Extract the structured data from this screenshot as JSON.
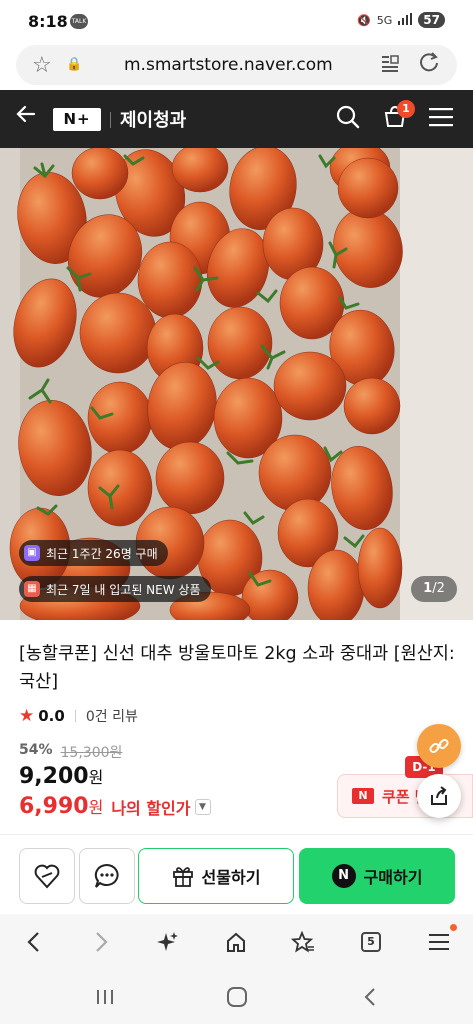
{
  "status_bar": {
    "time": "8:18",
    "talk_label": "TALK",
    "network": "5G",
    "battery": "57"
  },
  "url_bar": {
    "url": "m.smartstore.naver.com"
  },
  "header": {
    "logo": "N+",
    "store_name": "제이청과",
    "cart_count": "1"
  },
  "gallery": {
    "chip_recent_purchase": "최근 1주간 26명 구매",
    "chip_new_stock": "최근 7일 내 입고된 NEW 상품",
    "page_current": "1",
    "page_total": "/2"
  },
  "product": {
    "title": "[농할쿠폰] 신선 대추 방울토마토 2kg 소과 중대과 [원산지: 국산]",
    "rating": "0.0",
    "review_count": "0건 리뷰",
    "discount_rate": "54%",
    "original_price": "15,300원",
    "sale_price": "9,200",
    "sale_price_unit": "원",
    "my_price": "6,990",
    "my_price_unit": "원",
    "my_price_label": "나의 할인가"
  },
  "coupon": {
    "badge": "D-1",
    "n_label": "N",
    "label": "쿠폰 받"
  },
  "actions": {
    "gift_label": "선물하기",
    "buy_label": "구매하기",
    "naver_n": "N"
  },
  "browser_nav": {
    "tab_count": "5"
  },
  "colors": {
    "header_bg": "#232323",
    "accent_green": "#21d26d",
    "accent_red": "#e72f2f",
    "fab_orange": "#f5a042"
  }
}
